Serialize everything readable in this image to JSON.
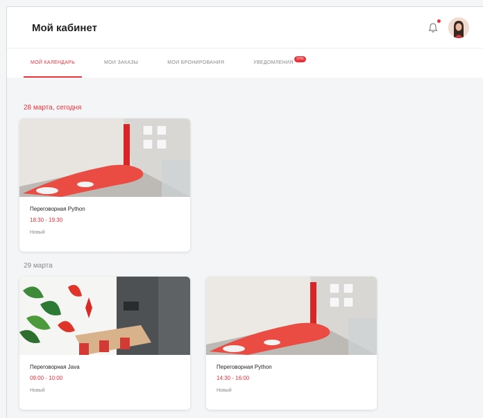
{
  "header": {
    "title": "Мой кабинет",
    "bell_icon": "bell-icon",
    "avatar_icon": "avatar"
  },
  "tabs": [
    {
      "label": "Мой календарь",
      "active": true
    },
    {
      "label": "Мои заказы",
      "active": false
    },
    {
      "label": "Мои бронирования",
      "active": false
    },
    {
      "label": "Уведомления",
      "active": false,
      "badge": "10%"
    }
  ],
  "days": [
    {
      "date": "28 марта, сегодня",
      "bookings": [
        {
          "room": "Переговорная Python",
          "time": "18:30 - 19:30",
          "status": "Новый",
          "photo": "python-room"
        }
      ]
    },
    {
      "date": "29 марта",
      "bookings": [
        {
          "room": "Переговорная Java",
          "time": "09:00 - 10:00",
          "status": "Новый",
          "photo": "java-room"
        },
        {
          "room": "Переговорная Python",
          "time": "14:30 - 16:00",
          "status": "Новый",
          "photo": "python-room"
        }
      ]
    }
  ],
  "colors": {
    "accent": "#e8323c",
    "background": "#f4f5f7"
  }
}
